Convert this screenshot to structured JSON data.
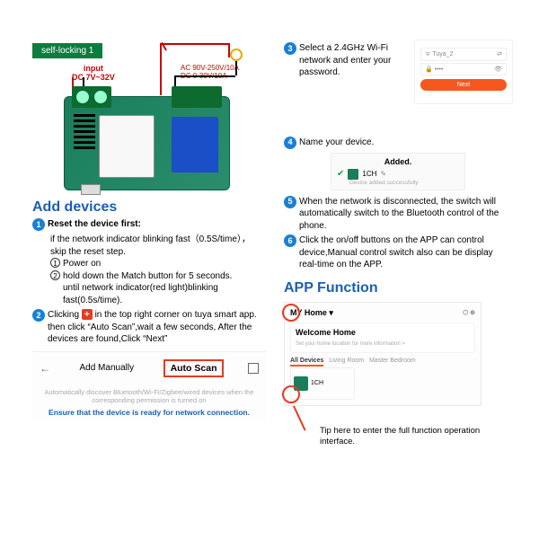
{
  "tag": "self-locking 1",
  "board": {
    "input_label": "input",
    "input_range": "DC 7V~32V",
    "ac_line1": "AC 90V-250V/10A",
    "ac_line2": "DC 0-30V/10A"
  },
  "left": {
    "heading": "Add devices",
    "step1_title": "Reset the device first:",
    "step1_sub1": "if the network indicator blinking fast（0.5S/time），skip the reset step.",
    "step1_a": "Power on",
    "step1_b1": "hold down the Match button for 5 seconds.",
    "step1_b2": "until  network indicator(red light)blinking fast(0.5s/time).",
    "step2_a": "Clicking ",
    "step2_b": " in the top right corner on tuya smart app. then click “Auto Scan”,wait a few seconds, After the devices are found,Click “Next”",
    "tabs": {
      "manual": "Add Manually",
      "auto": "Auto Scan"
    },
    "hint_grey": "Automatically discover Bluetooth/Wi-Fi/Zigbee/wired devices when the corresponding permission is turned on",
    "hint_blue": "Ensure that the device is ready for network connection."
  },
  "right": {
    "step3": "Select a 2.4GHz Wi-Fi network and enter your password.",
    "wifi": {
      "ssid": "Tuya_2",
      "next": "Next"
    },
    "step4": "Name your device.",
    "added": {
      "title": "Added.",
      "name": "1CH",
      "sub": "Device added successfully"
    },
    "step5": "When the network is disconnected, the switch will automatically switch to the Bluetooth control of the phone.",
    "step6": "Click the on/off buttons on the APP can control device,Manual control switch also can be display real-time on the APP.",
    "heading2": "APP Function",
    "home": {
      "title": "MY Home ▾",
      "welcome": "Welcome Home",
      "welcome_sub": "Set your home location for more information >",
      "tabs_all": "All Devices",
      "tabs_living": "Living Room",
      "tabs_master": "Master Bedroom",
      "device": "1CH"
    },
    "tip": "Tip here to enter the full function operation interface."
  }
}
